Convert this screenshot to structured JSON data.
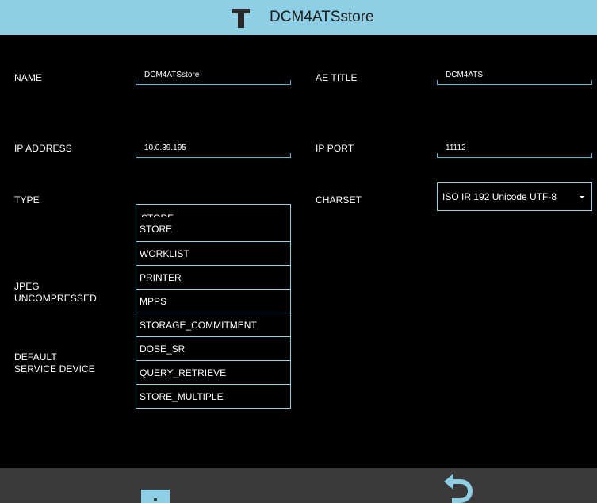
{
  "header": {
    "title": "DCM4ATSstore"
  },
  "form": {
    "name_label": "NAME",
    "name_value": "DCM4ATSstore",
    "ae_title_label": "AE TITLE",
    "ae_title_value": "DCM4ATS",
    "ip_address_label": "IP ADDRESS",
    "ip_address_value": "10.0.39.195",
    "ip_port_label": "IP PORT",
    "ip_port_value": "11112",
    "type_label": "TYPE",
    "type_value": "STORE",
    "charset_label": "CHARSET",
    "charset_value": "ISO IR 192 Unicode UTF-8",
    "jpeg_label_line1": "JPEG",
    "jpeg_label_line2": "UNCOMPRESSED",
    "default_label_line1": "DEFAULT",
    "default_label_line2": "SERVICE DEVICE"
  },
  "type_options": [
    "STORE",
    "WORKLIST",
    "PRINTER",
    "MPPS",
    "STORAGE_COMMITMENT",
    "DOSE_SR",
    "QUERY_RETRIEVE",
    "STORE_MULTIPLE"
  ],
  "icons": {
    "header_icon": "t-logo-icon",
    "save": "save-icon",
    "back": "undo-arrow-icon"
  },
  "colors": {
    "header_bg": "#8fcfe6",
    "accent": "#5fb4d4",
    "footer_bg": "#3a3a3a",
    "page_bg": "#000000"
  }
}
